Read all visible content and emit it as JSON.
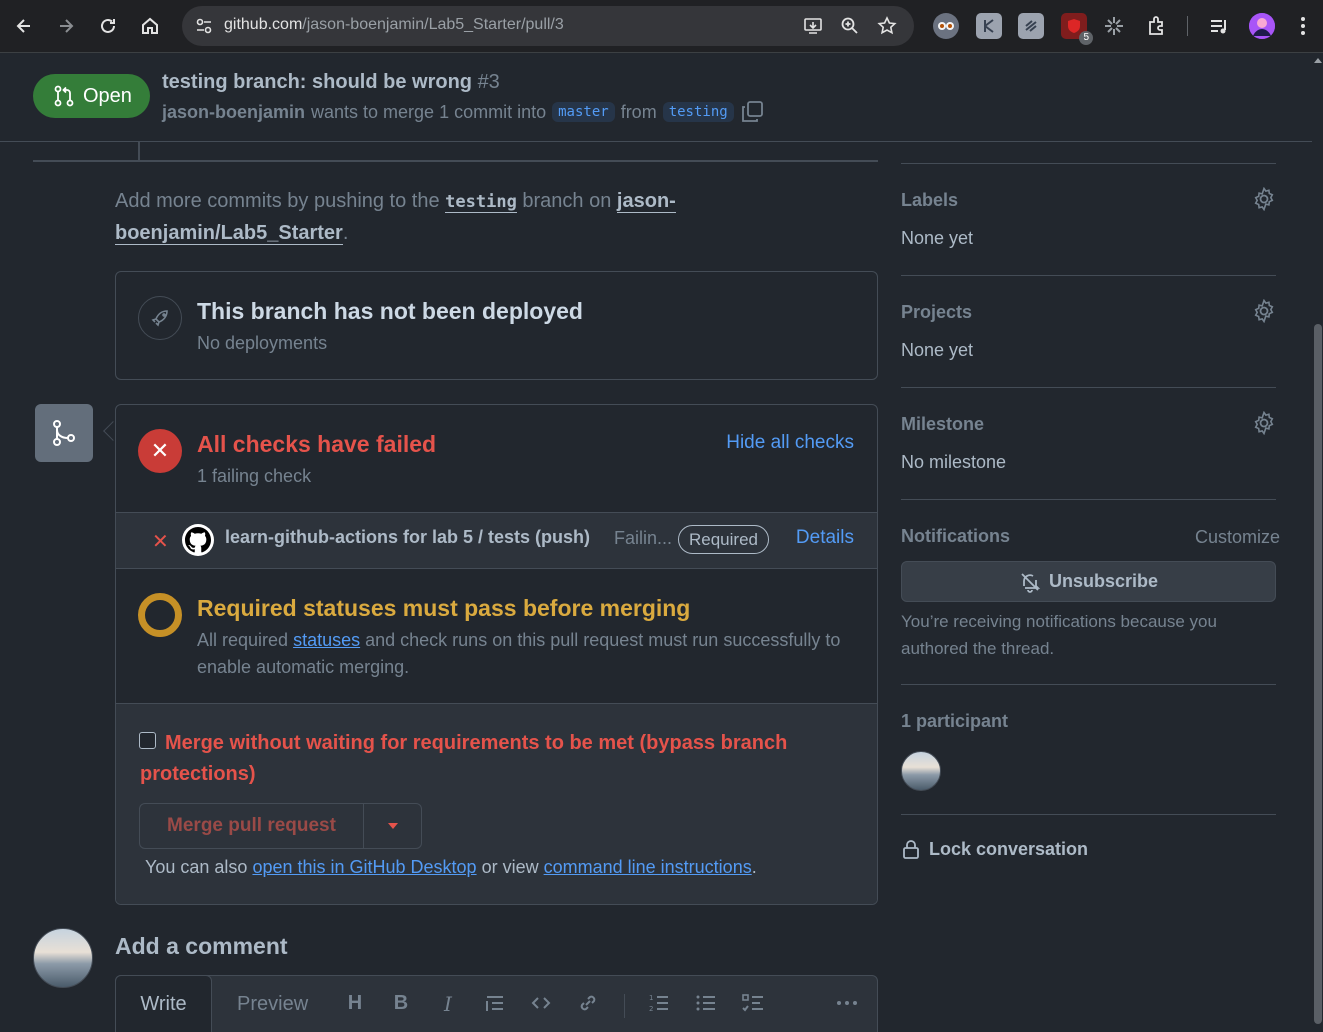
{
  "browser": {
    "url_host": "github.com",
    "url_path": "/jason-boenjamin/Lab5_Starter/pull/3",
    "ext_badge": "5"
  },
  "pr": {
    "state": "Open",
    "title": "testing branch: should be wrong",
    "number": "#3",
    "author": "jason-boenjamin",
    "merge_text": "wants to merge 1 commit into",
    "base_branch": "master",
    "from_text": "from",
    "head_branch": "testing"
  },
  "push_note": {
    "prefix": "Add more commits by pushing to the",
    "branch": "testing",
    "middle": "branch on",
    "repo_line1": "jason-",
    "repo_line2": "boenjamin/Lab5_Starter",
    "suffix": "."
  },
  "deploy": {
    "title": "This branch has not been deployed",
    "subtitle": "No deployments"
  },
  "checks": {
    "title": "All checks have failed",
    "subtitle": "1 failing check",
    "hide_label": "Hide all checks",
    "run_name": "learn-github-actions for lab 5 / tests (push)",
    "run_status": "Failin...",
    "run_badge": "Required",
    "run_details": "Details"
  },
  "required": {
    "title": "Required statuses must pass before merging",
    "text_before": "All required",
    "link": "statuses",
    "text_after": "and check runs on this pull request must run successfully to enable automatic merging."
  },
  "merge": {
    "bypass_label": "Merge without waiting for requirements to be met (bypass branch protections)",
    "button": "Merge pull request",
    "also_prefix": "You can also",
    "desktop_link": "open this in GitHub Desktop",
    "also_middle": "or view",
    "cli_link": "command line instructions",
    "also_suffix": "."
  },
  "comment": {
    "title": "Add a comment",
    "tab_write": "Write",
    "tab_preview": "Preview"
  },
  "sidebar": {
    "labels": {
      "heading": "Labels",
      "value": "None yet"
    },
    "projects": {
      "heading": "Projects",
      "value": "None yet"
    },
    "milestone": {
      "heading": "Milestone",
      "value": "No milestone"
    },
    "notifications": {
      "heading": "Notifications",
      "customize": "Customize",
      "button": "Unsubscribe",
      "text": "You’re receiving notifications because you authored the thread."
    },
    "participants": {
      "heading": "1 participant"
    },
    "lock": "Lock conversation"
  },
  "colors": {
    "open_green": "#347d39",
    "fail_red": "#e5534b",
    "pending_yellow": "#daaa3f",
    "link_blue": "#539bf5",
    "bg": "#22272e"
  }
}
